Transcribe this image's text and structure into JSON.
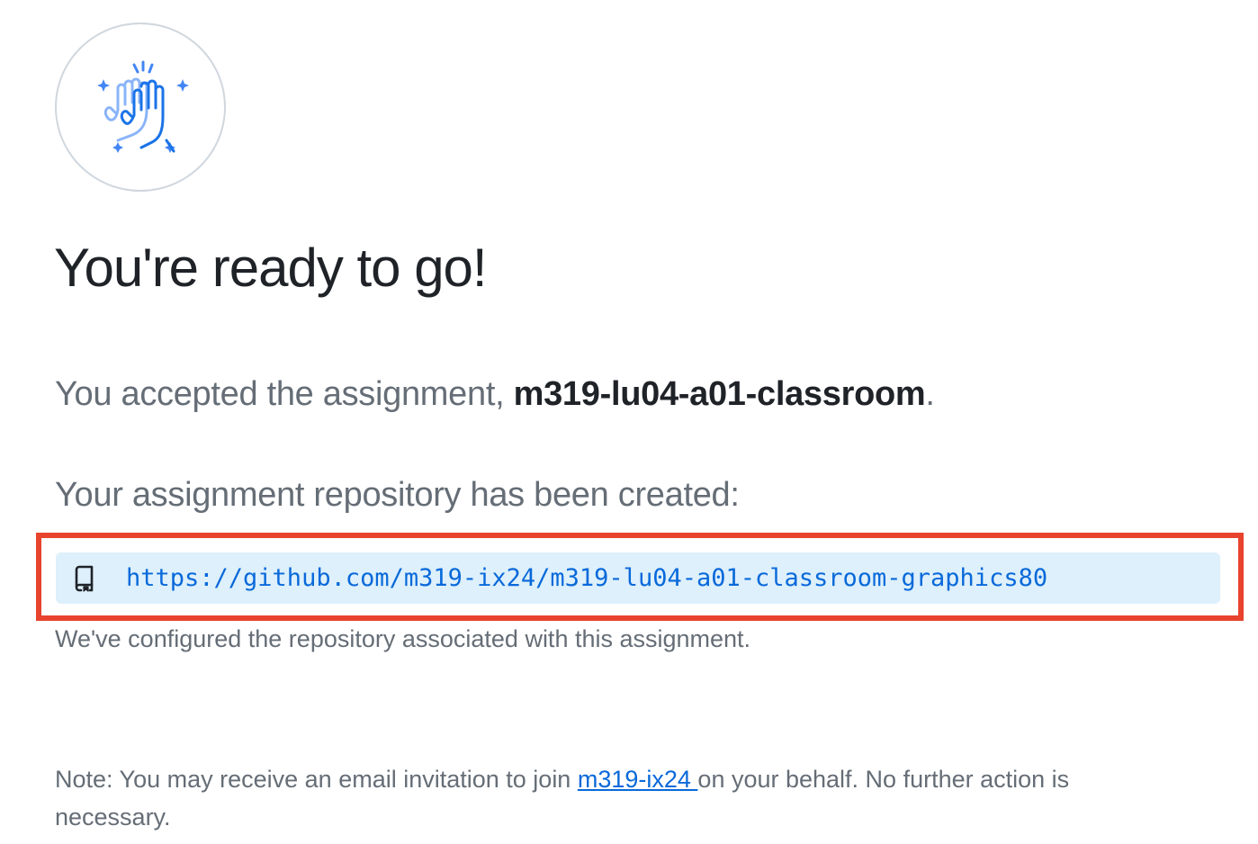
{
  "hero": {
    "icon": "high-five-icon",
    "icon_color": "#4285f4"
  },
  "title": "You're ready to go!",
  "accepted": {
    "prefix": "You accepted the assignment, ",
    "assignment_name": "m319-lu04-a01-classroom",
    "suffix": "."
  },
  "repository": {
    "heading": "Your assignment repository has been created:",
    "icon": "repo-icon",
    "url": "https://github.com/m319-ix24/m319-lu04-a01-classroom-graphics80",
    "box_color": "#ddf0fb",
    "highlight_color": "#e8432d"
  },
  "configured_note": "We've configured the repository associated with this assignment.",
  "note": {
    "before": "Note: You may receive an email invitation to join ",
    "org_link": "m319-ix24 ",
    "after": "on your behalf. No further action is necessary."
  },
  "colors": {
    "text_primary": "#1f2328",
    "text_secondary": "#656d76",
    "link": "#0969da"
  }
}
